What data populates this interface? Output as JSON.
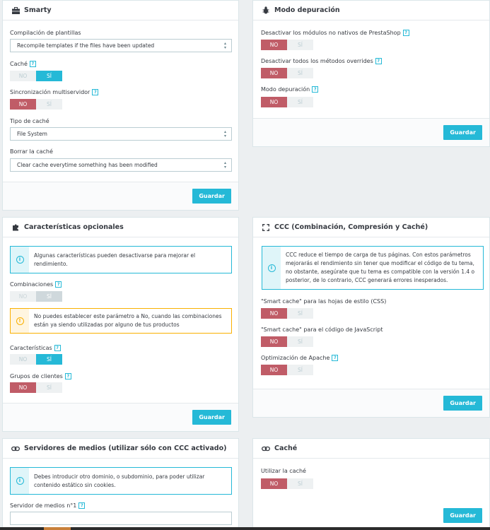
{
  "smarty": {
    "title": "Smarty",
    "compile_label": "Compilación de plantillas",
    "compile_value": "Recompile templates if the files have been updated",
    "cache_label": "Caché",
    "sync_label": "Sincronización multiservidor",
    "cache_type_label": "Tipo de caché",
    "cache_type_value": "File System",
    "clear_label": "Borrar la caché",
    "clear_value": "Clear cache everytime something has been modified",
    "save": "Guardar"
  },
  "debug": {
    "title": "Modo depuración",
    "disable_modules_label": "Desactivar los módulos no nativos de PrestaShop",
    "disable_overrides_label": "Desactivar todos los métodos overrides",
    "debug_mode_label": "Modo depuración",
    "save": "Guardar"
  },
  "optional": {
    "title": "Características opcionales",
    "info": "Algunas características pueden desactivarse para mejorar el rendimiento.",
    "combinations_label": "Combinaciones",
    "warning": "No puedes establecer este parámetro a No, cuando las combinaciones están ya siendo utilizadas por alguno de tus productos",
    "features_label": "Características",
    "groups_label": "Grupos de clientes",
    "save": "Guardar"
  },
  "ccc": {
    "title": "CCC (Combinación, Compresión y Caché)",
    "info": "CCC reduce el tiempo de carga de tus páginas. Con estos parámetros mejorarás el rendimiento sin tener que modificar el código de tu tema, no obstante, asegúrate que tu tema es compatible con la versión 1.4 o posterior, de lo contrario, CCC generará errores inesperados.",
    "css_label": "\"Smart cache\" para las hojas de estilo (CSS)",
    "js_label": "\"Smart cache\" para el código de JavaScript",
    "apache_label": "Optimización de Apache",
    "save": "Guardar"
  },
  "media": {
    "title": "Servidores de medios (utilizar sólo con CCC activado)",
    "info": "Debes introducir otro dominio, o subdominio, para poder utilizar contenido estático sin cookies.",
    "server1_label": "Servidor de medios n°1",
    "server1_value": ""
  },
  "cache": {
    "title": "Caché",
    "use_label": "Utilizar la caché",
    "save": "Guardar"
  },
  "switch": {
    "no": "NO",
    "yes": "SÍ"
  },
  "help": "?",
  "info_glyph": "i",
  "warn_glyph": "!",
  "caret": "▲▼",
  "colors": {
    "accent": "#25b9d7",
    "no_active": "#c05c67",
    "warning": "#fab000"
  },
  "icons": [
    "briefcase-icon",
    "bug-icon",
    "puzzle-icon",
    "expand-icon",
    "link-icon",
    "info-icon",
    "warning-icon"
  ]
}
